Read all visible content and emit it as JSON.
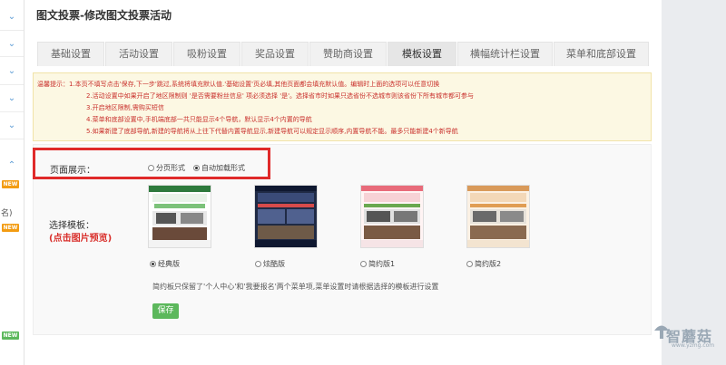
{
  "page": {
    "title": "图文投票-修改图文投票活动"
  },
  "tabs": [
    {
      "label": "基础设置"
    },
    {
      "label": "活动设置"
    },
    {
      "label": "吸粉设置"
    },
    {
      "label": "奖品设置"
    },
    {
      "label": "赞助商设置"
    },
    {
      "label": "模板设置",
      "active": true
    },
    {
      "label": "横幅统计栏设置"
    },
    {
      "label": "菜单和底部设置"
    }
  ],
  "notice": {
    "lines": [
      "温馨提示：1.本页不填写点击'保存,下一步'跳过,系统将填充默认值.'基础设置'页必填,其他页面都会填充默认值。编辑时上面的选项可以任意切换",
      "2.活动设置中如果开启了地区限制则 '是否需要粉丝信息' 项必须选择 '是'。选择省市时如果只选省份不选城市则该省份下所有城市都可参与",
      "3.开启地区限制,需购买短信",
      "4.菜单和底部设置中,手机端底部一共只能显示4个导航，默认显示4个内置的导航",
      "5.如果新建了底部导航,新建的导航将从上往下代替内置导航显示,新建导航可以规定显示顺序,内置导航不能。最多只能新建4个新导航"
    ]
  },
  "display": {
    "label": "页面展示：",
    "options": [
      {
        "label": "分页形式",
        "checked": false
      },
      {
        "label": "自动加载形式",
        "checked": true
      }
    ]
  },
  "template": {
    "label": "选择模板：",
    "sublabel": "(点击图片预览)",
    "options": [
      {
        "label": "经典版",
        "checked": true
      },
      {
        "label": "炫酷版",
        "checked": false
      },
      {
        "label": "简约版1",
        "checked": false
      },
      {
        "label": "简约版2",
        "checked": false
      }
    ],
    "hint": "简约板只保留了'个人中心'和'我要报名'两个菜单项,菜单设置时请根据选择的模板进行设置"
  },
  "actions": {
    "save_label": "保存"
  },
  "sidebar": {
    "new_badge": "NEW",
    "partial_text": "名)"
  },
  "watermark": {
    "text": "智蘑菇",
    "url": "www.yzmg.com"
  },
  "colors": {
    "accent_green": "#5cb85c",
    "highlight_red": "#e02a2a",
    "notice_bg": "#fcf8e3",
    "warn_red": "#c9302c"
  }
}
